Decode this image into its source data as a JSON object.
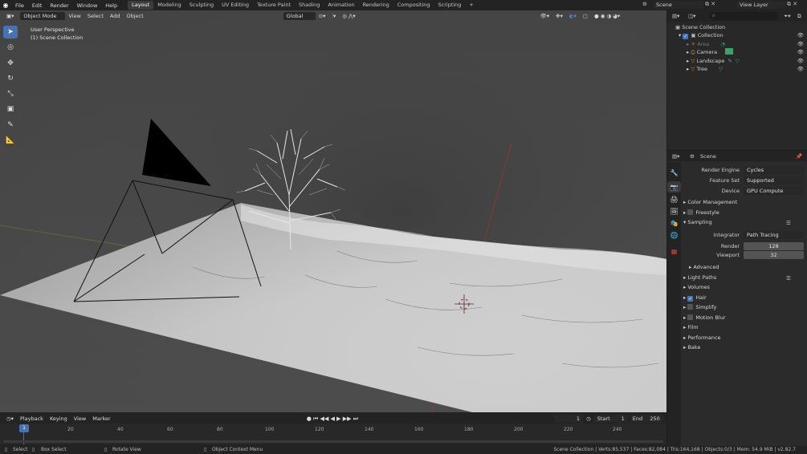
{
  "menu": [
    "File",
    "Edit",
    "Render",
    "Window",
    "Help"
  ],
  "workspaces": [
    "Layout",
    "Modeling",
    "Sculpting",
    "UV Editing",
    "Texture Paint",
    "Shading",
    "Animation",
    "Rendering",
    "Compositing",
    "Scripting"
  ],
  "active_workspace": "Layout",
  "add_tab": "+",
  "scene_name": "Scene",
  "view_layer": "View Layer",
  "viewport_header": {
    "mode": "Object Mode",
    "view": "View",
    "select": "Select",
    "add": "Add",
    "object": "Object",
    "orientation": "Global"
  },
  "viewport": {
    "title": "User Perspective",
    "subtitle": "(1) Scene Collection"
  },
  "outliner": {
    "search_placeholder": "",
    "root": "Scene Collection",
    "collection": "Collection",
    "items": [
      "Area",
      "Camera",
      "Landscape",
      "Tree"
    ]
  },
  "properties": {
    "scene": "Scene",
    "render_engine_label": "Render Engine",
    "render_engine": "Cycles",
    "feature_set_label": "Feature Set",
    "feature_set": "Supported",
    "device_label": "Device",
    "device": "GPU Compute",
    "color_management": "Color Management",
    "freestyle": "Freestyle",
    "sampling": "Sampling",
    "integrator_label": "Integrator",
    "integrator": "Path Tracing",
    "render_label": "Render",
    "render_samples": "128",
    "viewport_label": "Viewport",
    "viewport_samples": "32",
    "advanced": "Advanced",
    "light_paths": "Light Paths",
    "volumes": "Volumes",
    "hair": "Hair",
    "simplify": "Simplify",
    "motion_blur": "Motion Blur",
    "film": "Film",
    "performance": "Performance",
    "bake": "Bake"
  },
  "timeline": {
    "playback": "Playback",
    "keying": "Keying",
    "view": "View",
    "marker": "Marker",
    "current_frame": "1",
    "start_label": "Start",
    "start": "1",
    "end_label": "End",
    "end": "250",
    "ticks": [
      "20",
      "40",
      "60",
      "80",
      "100",
      "120",
      "140",
      "160",
      "180",
      "200",
      "220",
      "240"
    ],
    "playhead": "1"
  },
  "status": {
    "select": "Select",
    "box_select": "Box Select",
    "rotate_view": "Rotate View",
    "context_menu": "Object Context Menu",
    "stats": "Scene Collection | Verts:85,537 | Faces:82,084 | Tris:164,168 | Objects:0/3 | Mem: 54.9 MiB | v2.82.7"
  },
  "colors": {
    "accent": "#4772b3",
    "header": "#232323",
    "viewport_bg": "#3d3d3d",
    "field": "#545454"
  }
}
